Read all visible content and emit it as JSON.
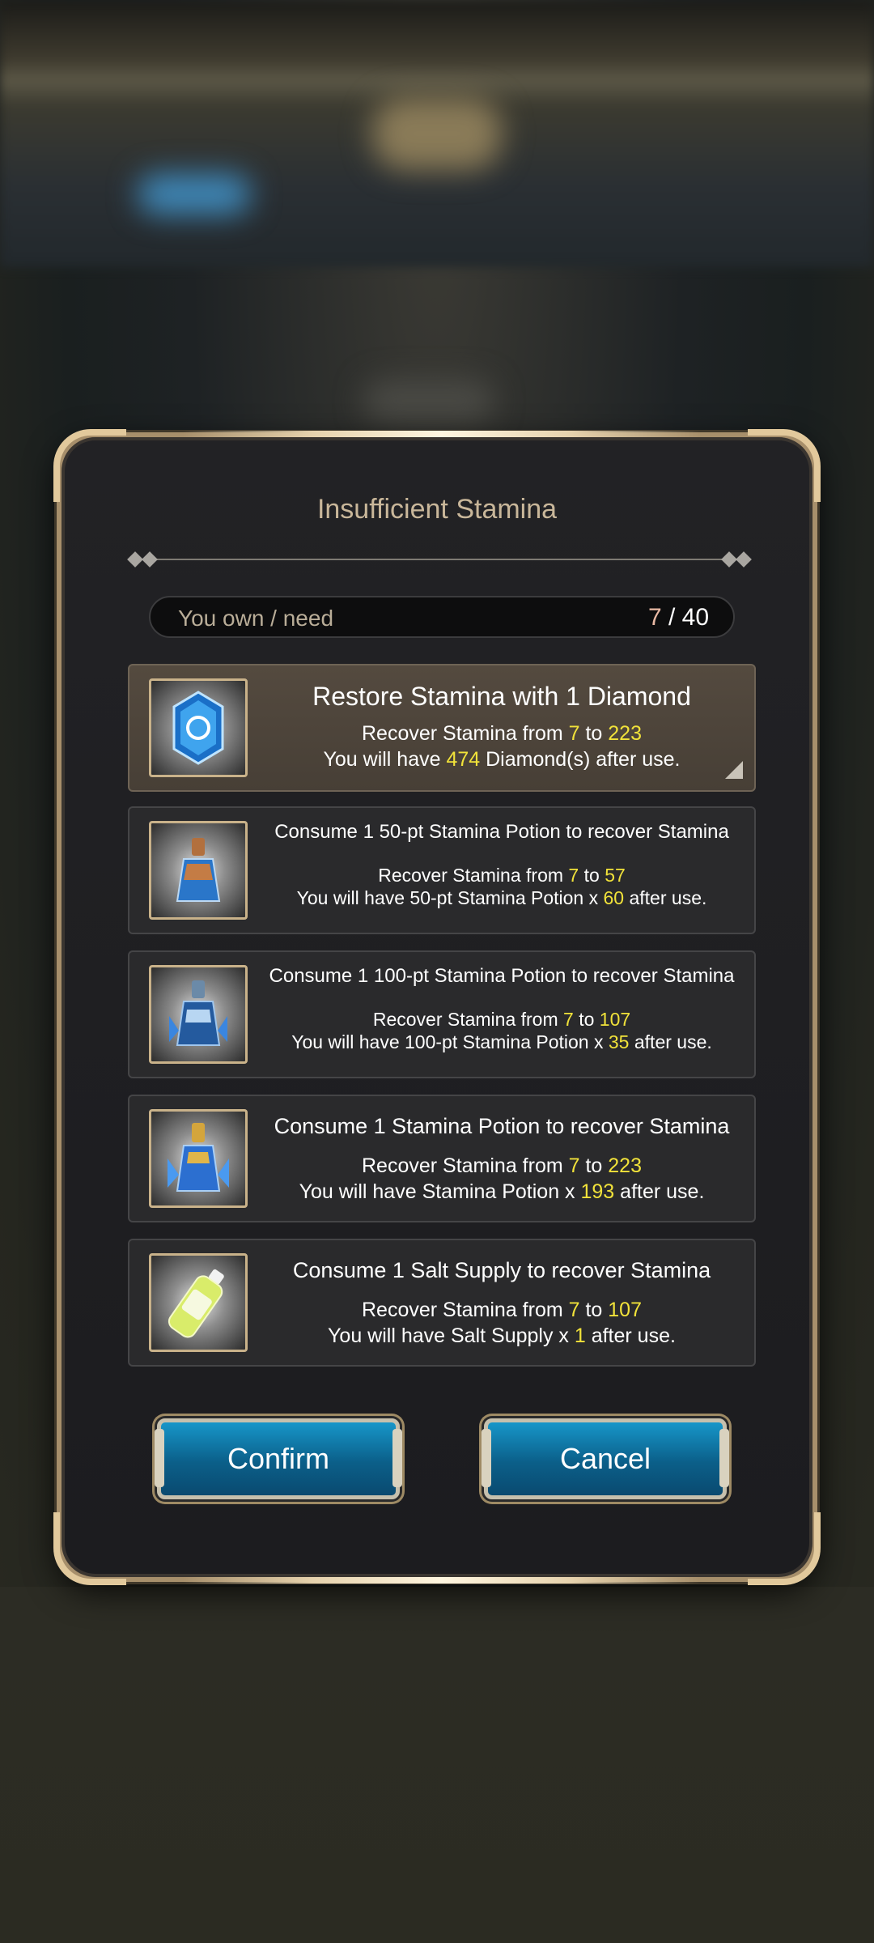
{
  "dialog": {
    "title": "Insufficient Stamina",
    "own_label": "You own / need",
    "own_current": "7",
    "own_rest": " / 40"
  },
  "options": [
    {
      "head": "Restore Stamina with 1 Diamond",
      "l1_pre": "Recover Stamina from ",
      "l1_from": "7",
      "l1_mid": " to ",
      "l1_to": "223",
      "l2_pre": "You will have ",
      "l2_val": "474",
      "l2_post": " Diamond(s) after use.",
      "icon": "diamond-icon"
    },
    {
      "head": "Consume 1 50-pt Stamina Potion to recover Stamina",
      "l1_pre": "Recover Stamina from ",
      "l1_from": "7",
      "l1_mid": " to ",
      "l1_to": "57",
      "l2_pre": "You will have 50-pt Stamina Potion x ",
      "l2_val": "60",
      "l2_post": " after use.",
      "icon": "stamina-potion-50-icon"
    },
    {
      "head": "Consume 1 100-pt Stamina Potion to recover Stamina",
      "l1_pre": "Recover Stamina from ",
      "l1_from": "7",
      "l1_mid": " to ",
      "l1_to": "107",
      "l2_pre": "You will have 100-pt Stamina Potion x ",
      "l2_val": "35",
      "l2_post": " after use.",
      "icon": "stamina-potion-100-icon"
    },
    {
      "head": "Consume 1 Stamina Potion to recover Stamina",
      "l1_pre": "Recover Stamina from ",
      "l1_from": "7",
      "l1_mid": " to ",
      "l1_to": "223",
      "l2_pre": "You will have Stamina Potion x ",
      "l2_val": "193",
      "l2_post": " after use.",
      "icon": "stamina-potion-icon"
    },
    {
      "head": "Consume 1 Salt Supply to recover Stamina",
      "l1_pre": "Recover Stamina from ",
      "l1_from": "7",
      "l1_mid": " to ",
      "l1_to": "107",
      "l2_pre": "You will have Salt Supply x ",
      "l2_val": "1",
      "l2_post": " after use.",
      "icon": "salt-supply-bottle-icon"
    }
  ],
  "buttons": {
    "confirm": "Confirm",
    "cancel": "Cancel"
  },
  "colors": {
    "highlight": "#f1e23a",
    "button_blue": "#0b5f89",
    "frame_gold": "#e2c99c"
  }
}
